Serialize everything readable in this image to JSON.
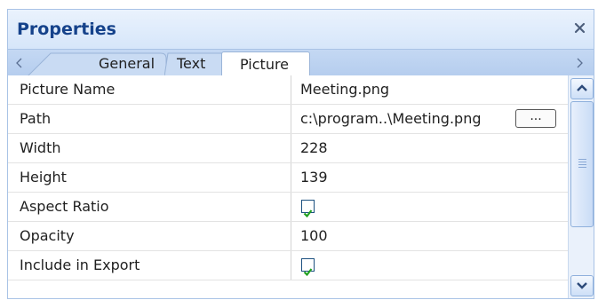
{
  "panel": {
    "title": "Properties",
    "close_icon": "close-icon"
  },
  "tabs": [
    {
      "label": "General",
      "active": false
    },
    {
      "label": "Text",
      "active": false
    },
    {
      "label": "Picture",
      "active": true
    }
  ],
  "rows": [
    {
      "name": "Picture Name",
      "value": "Meeting.png"
    },
    {
      "name": "Path",
      "value": "c:\\program..\\Meeting.png",
      "button": "..."
    },
    {
      "name": "Width",
      "value": "228"
    },
    {
      "name": "Height",
      "value": "139"
    },
    {
      "name": "Aspect Ratio",
      "checked": true
    },
    {
      "name": "Opacity",
      "value": "100"
    },
    {
      "name": "Include in Export",
      "checked": true
    }
  ],
  "colors": {
    "title": "#15428b",
    "panel_background": "#d9e8fa",
    "check": "#21a121"
  }
}
